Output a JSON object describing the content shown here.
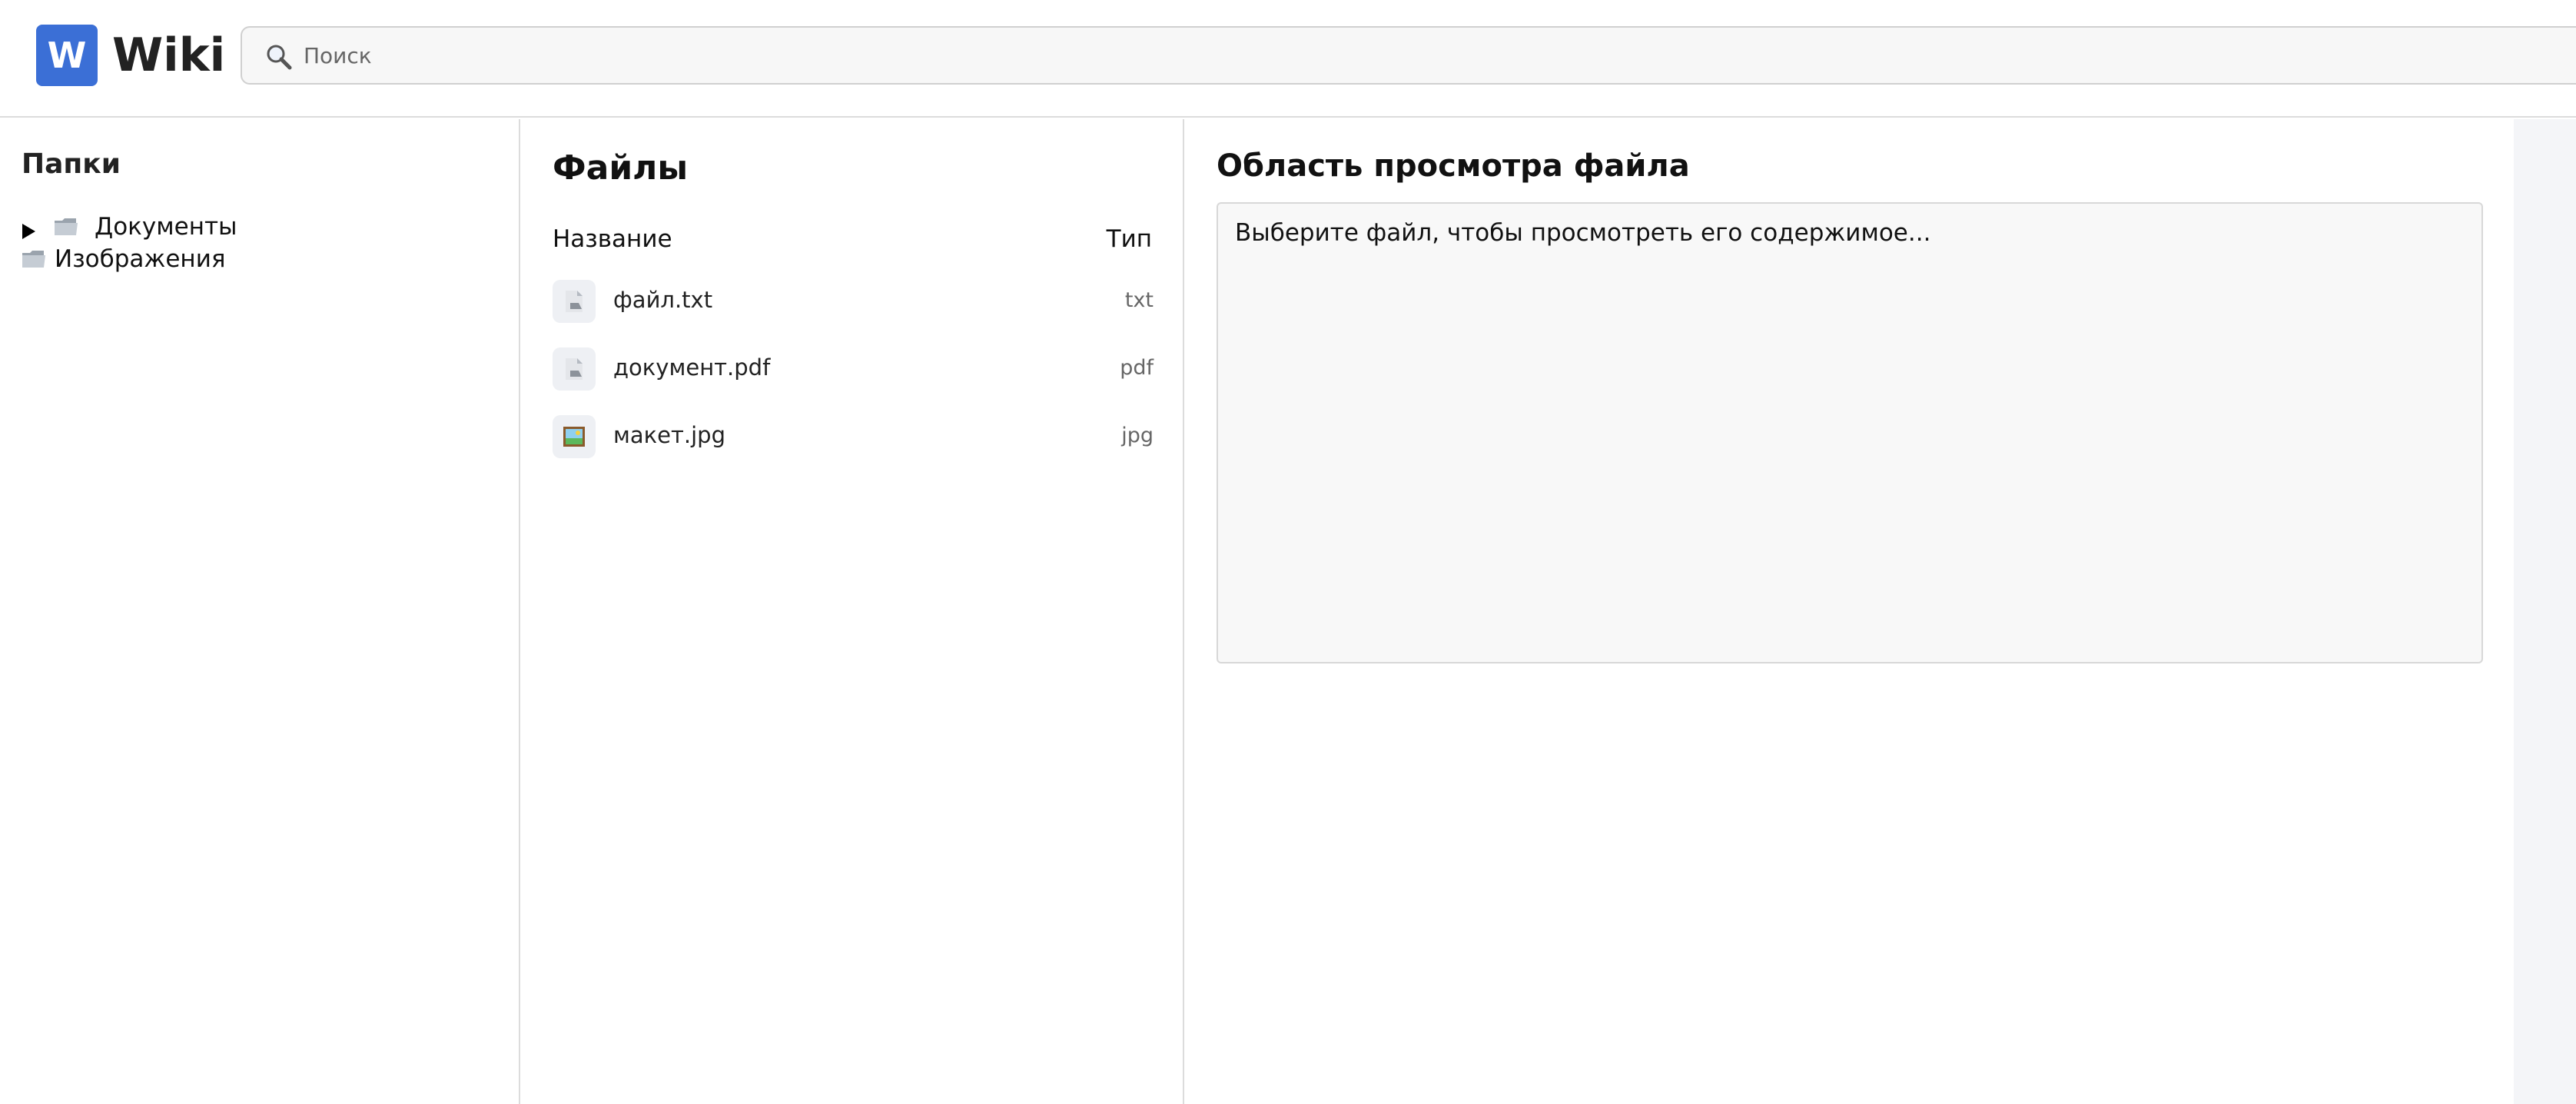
{
  "header": {
    "logo_letter": "W",
    "brand": "Wiki",
    "search_placeholder": "Поиск",
    "search_icon": "magnifier-icon"
  },
  "folders": {
    "title": "Папки",
    "items": [
      {
        "label": "Документы",
        "icon": "folder-icon",
        "expandable": true,
        "expanded": false
      },
      {
        "label": "Изображения",
        "icon": "folder-icon",
        "expandable": false
      }
    ]
  },
  "files": {
    "title": "Файлы",
    "columns": {
      "name": "Название",
      "type": "Тип"
    },
    "rows": [
      {
        "name": "файл.txt",
        "type": "txt",
        "icon": "document-icon"
      },
      {
        "name": "документ.pdf",
        "type": "pdf",
        "icon": "document-icon"
      },
      {
        "name": "макет.jpg",
        "type": "jpg",
        "icon": "image-icon"
      }
    ]
  },
  "preview": {
    "title": "Область просмотра файла",
    "placeholder_text": "Выберите файл, чтобы просмотреть его содержимое..."
  },
  "colors": {
    "accent": "#3b6fd6",
    "border": "#dcdcdc",
    "preview_bg": "#f8f8f8"
  }
}
